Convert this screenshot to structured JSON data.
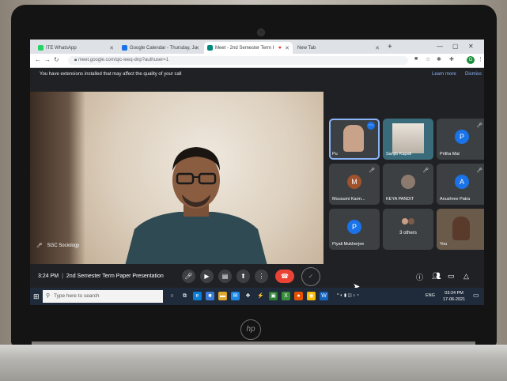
{
  "browser": {
    "tabs": [
      {
        "label": "ITE WhatsApp",
        "favicon_color": "#25d366"
      },
      {
        "label": "Google Calendar - Thursday, Ju",
        "favicon_color": "#1a73e8"
      },
      {
        "label": "Meet - 2nd Semester Term I",
        "favicon_color": "#00897b"
      },
      {
        "label": "New Tab",
        "favicon_color": "#9aa0a6"
      }
    ],
    "url": "meet.google.com/qic-ieeq-dnp?authuser=1",
    "profile_initial": "G"
  },
  "infobar": {
    "message": "You have extensions installed that may affect the quality of your call",
    "learn_more": "Learn more",
    "dismiss": "Dismiss"
  },
  "meet": {
    "presenter_label": "SGC Sociology",
    "time": "3:24 PM",
    "meeting_title": "2nd Semester Term Paper Presentation",
    "participants": [
      {
        "name": "Pu",
        "avatar": "",
        "kind": "video"
      },
      {
        "name": "Sanjib Kapali",
        "avatar": "",
        "kind": "video"
      },
      {
        "name": "Pritha Mal",
        "avatar": "P",
        "kind": "avatar"
      },
      {
        "name": "Mousumi Karm...",
        "avatar": "M",
        "kind": "avatar"
      },
      {
        "name": "KEYA PANDIT",
        "avatar": "",
        "kind": "photo"
      },
      {
        "name": "Anushree Patra",
        "avatar": "A",
        "kind": "avatar"
      },
      {
        "name": "Piyali Mukherjee",
        "avatar": "P",
        "kind": "avatar"
      },
      {
        "name": "3 others",
        "avatar": "",
        "kind": "others"
      },
      {
        "name": "You",
        "avatar": "",
        "kind": "video"
      }
    ]
  },
  "taskbar": {
    "search_placeholder": "Type here to search",
    "lang": "ENG",
    "time": "03:24 PM",
    "date": "17-06-2021"
  },
  "laptop": {
    "brand": "hp"
  },
  "colors": {
    "meet_bg": "#202124",
    "end_call_red": "#ea4335",
    "avatar_blue": "#1a73e8",
    "avatar_brown": "#a0522d",
    "link_blue": "#8ab4f8"
  }
}
